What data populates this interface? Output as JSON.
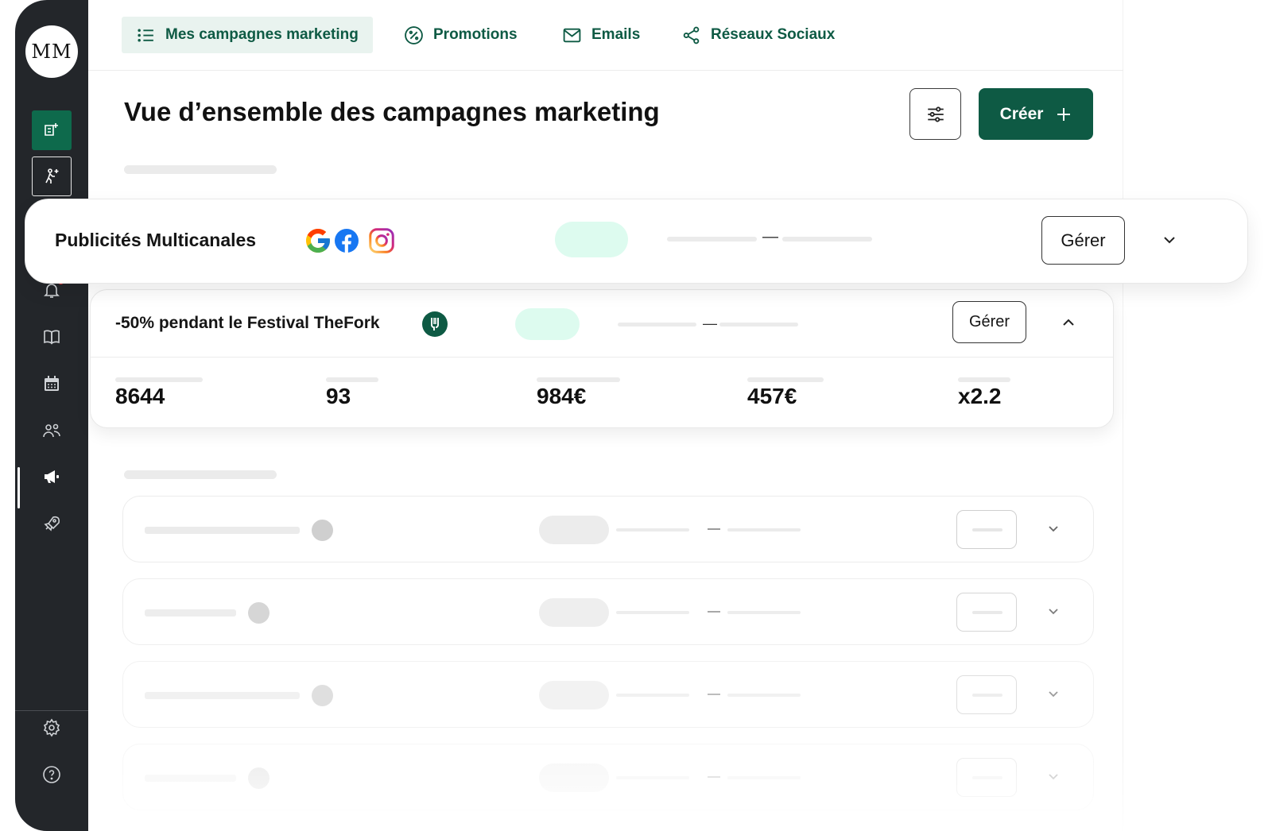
{
  "sidebar": {
    "avatar_initials": "MM",
    "items": [
      {
        "icon": "store-add-icon",
        "active": true
      },
      {
        "icon": "walking-person-add-icon",
        "active": false
      },
      {
        "icon": "bell-icon",
        "active": false,
        "notification": true
      },
      {
        "icon": "book-icon",
        "active": false
      },
      {
        "icon": "calendar-icon",
        "active": false
      },
      {
        "icon": "users-icon",
        "active": false
      },
      {
        "icon": "megaphone-icon",
        "active": true
      },
      {
        "icon": "rocket-icon",
        "active": false
      },
      {
        "icon": "gear-icon",
        "active": false
      },
      {
        "icon": "help-icon",
        "active": false
      }
    ]
  },
  "topnav": {
    "tabs": [
      {
        "label": "Mes campagnes marketing",
        "icon": "list-icon",
        "active": true
      },
      {
        "label": "Promotions",
        "icon": "percent-icon",
        "active": false
      },
      {
        "label": "Emails",
        "icon": "mail-icon",
        "active": false
      },
      {
        "label": "Réseaux Sociaux",
        "icon": "share-icon",
        "active": false
      }
    ]
  },
  "header": {
    "title": "Vue d’ensemble des campagnes marketing",
    "create_label": "Créer",
    "create_icon": "plus-icon",
    "filter_icon": "sliders-icon"
  },
  "featured_card": {
    "title": "Publicités Multicanales",
    "channels": [
      "google-icon",
      "facebook-icon",
      "instagram-icon"
    ],
    "manage_label": "Gérer",
    "date_separator": "—"
  },
  "expanded_card": {
    "title": "-50% pendant le Festival TheFork",
    "logo": "thefork-icon",
    "manage_label": "Gérer",
    "date_separator": "—",
    "stats": [
      "8644",
      "93",
      "984€",
      "457€",
      "x2.2"
    ]
  },
  "faded_rows": [
    {
      "date_separator": "—"
    },
    {
      "date_separator": "—"
    },
    {
      "date_separator": "—"
    },
    {
      "date_separator": "—"
    }
  ],
  "colors": {
    "brand_green": "#0e5a44",
    "active_green": "#0e6a4c",
    "sidebar_bg": "#23262a",
    "status_pill": "#ddfbef"
  }
}
